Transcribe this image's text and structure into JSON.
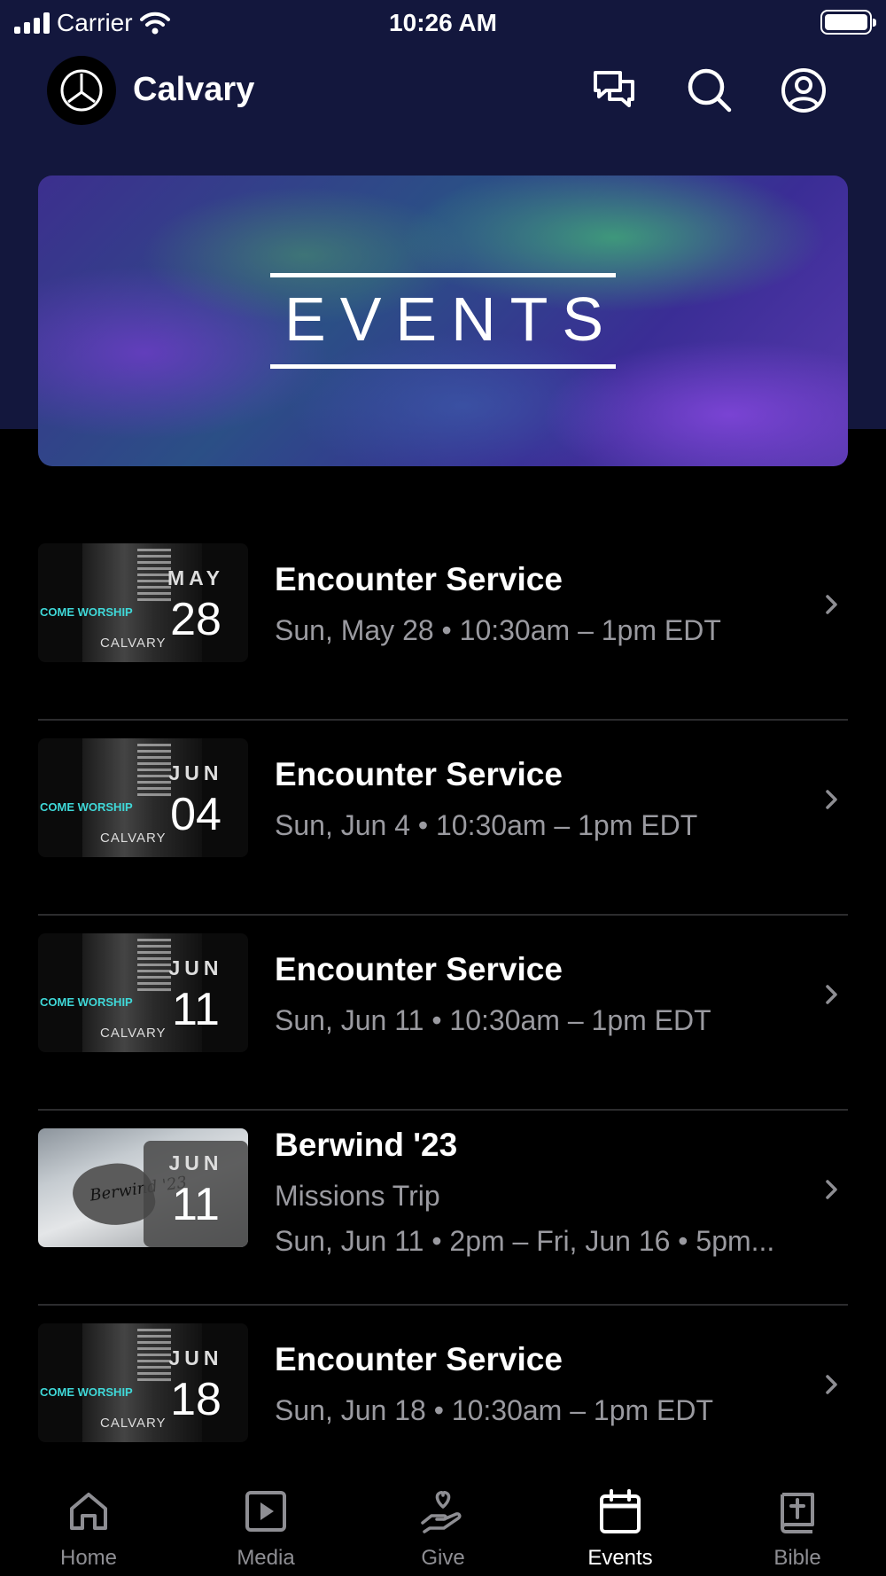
{
  "status_bar": {
    "carrier": "Carrier",
    "time": "10:26 AM"
  },
  "header": {
    "brand": "Calvary",
    "logo_icon": "calvary-logo-icon",
    "actions": [
      "chat-icon",
      "search-icon",
      "profile-icon"
    ]
  },
  "banner": {
    "title": "EVENTS"
  },
  "events": [
    {
      "title": "Encounter Service",
      "month": "MAY",
      "day": "28",
      "lines": [
        "Sun, May 28 • 10:30am – 1pm EDT"
      ],
      "thumb": {
        "line1": "COME WORSHIP",
        "line2": "CALVARY"
      }
    },
    {
      "title": "Encounter Service",
      "month": "JUN",
      "day": "04",
      "lines": [
        "Sun, Jun 4 • 10:30am – 1pm EDT"
      ],
      "thumb": {
        "line1": "COME WORSHIP",
        "line2": "CALVARY"
      }
    },
    {
      "title": "Encounter Service",
      "month": "JUN",
      "day": "11",
      "lines": [
        "Sun, Jun 11 • 10:30am – 1pm EDT"
      ],
      "thumb": {
        "line1": "COME WORSHIP",
        "line2": "CALVARY"
      }
    },
    {
      "title": "Berwind '23",
      "month": "JUN",
      "day": "11",
      "lines": [
        "Missions Trip",
        "Sun, Jun 11 • 2pm – Fri, Jun 16 • 5pm..."
      ],
      "thumb": {
        "line1": "Berwind '23"
      }
    },
    {
      "title": "Encounter Service",
      "month": "JUN",
      "day": "18",
      "lines": [
        "Sun, Jun 18 • 10:30am – 1pm EDT"
      ],
      "thumb": {
        "line1": "COME WORSHIP",
        "line2": "CALVARY"
      }
    }
  ],
  "tabs": [
    {
      "label": "Home",
      "icon": "home-icon",
      "active": false
    },
    {
      "label": "Media",
      "icon": "media-icon",
      "active": false
    },
    {
      "label": "Give",
      "icon": "give-icon",
      "active": false
    },
    {
      "label": "Events",
      "icon": "calendar-icon",
      "active": true
    },
    {
      "label": "Bible",
      "icon": "bible-icon",
      "active": false
    }
  ],
  "colors": {
    "header_bg": "#13173d",
    "background": "#000000",
    "muted_text": "#9a9aa0",
    "tab_inactive": "#8e8e93"
  }
}
